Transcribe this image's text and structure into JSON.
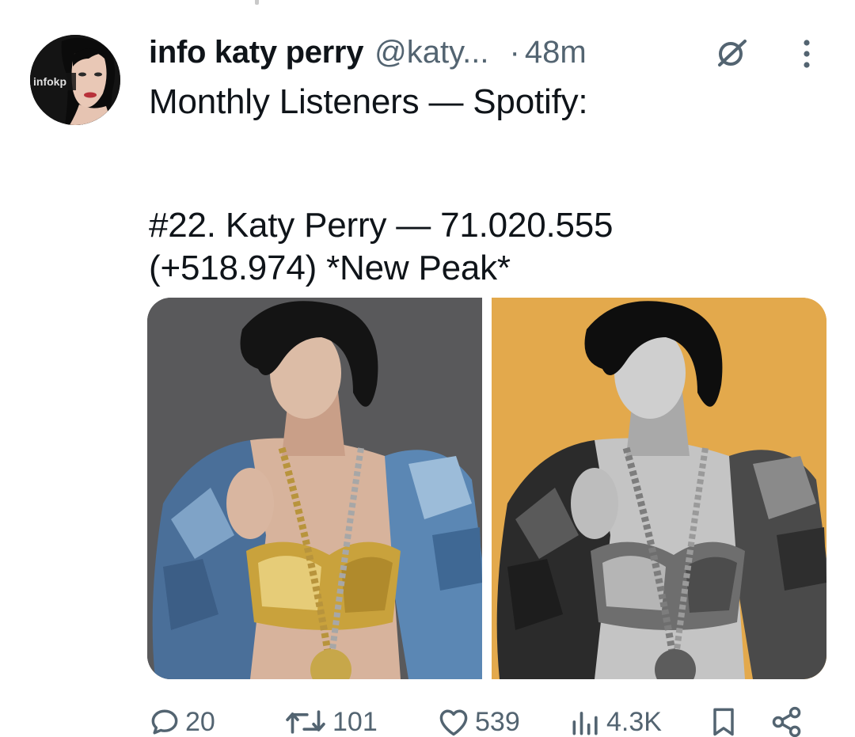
{
  "author": {
    "display_name": "info katy perry",
    "handle": "@katy...",
    "separator": "·",
    "time": "48m",
    "avatar_text": "infokp"
  },
  "tweet": {
    "line1": "Monthly Listeners — Spotify:",
    "line2": "#22. Katy Perry — 71.020.555",
    "line3": "(+518.974) *New Peak*"
  },
  "media": {
    "count": 2,
    "left_background": "#59595b",
    "right_background": "#e3a94c"
  },
  "actions": {
    "replies": "20",
    "reposts": "101",
    "likes": "539",
    "views": "4.3K"
  },
  "icons": [
    "grok-icon",
    "more-icon",
    "reply-icon",
    "repost-icon",
    "like-icon",
    "views-icon",
    "bookmark-icon",
    "share-icon"
  ],
  "colors": {
    "text_primary": "#0f1419",
    "text_secondary": "#536471",
    "background": "#ffffff"
  }
}
